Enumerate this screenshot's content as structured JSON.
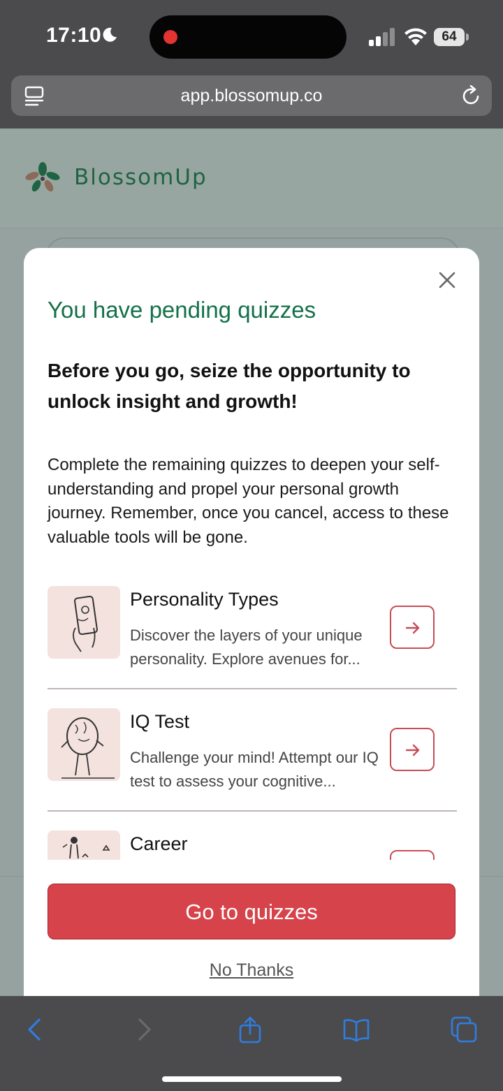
{
  "status_bar": {
    "time": "17:10",
    "battery": "64"
  },
  "browser": {
    "url": "app.blossomup.co"
  },
  "page": {
    "brand": "BlossomUp"
  },
  "modal": {
    "title": "You have pending quizzes",
    "subtitle": "Before you go, seize the opportunity to unlock insight and growth!",
    "body": "Complete the remaining quizzes to deepen your self-understanding and propel your personal growth journey. Remember, once you cancel, access to these valuable tools will be gone.",
    "quizzes": [
      {
        "name": "Personality Types",
        "description": "Discover the layers of your unique personality. Explore avenues for..."
      },
      {
        "name": "IQ Test",
        "description": "Challenge your mind! Attempt our IQ test to assess your cognitive..."
      },
      {
        "name": "Career",
        "description": ""
      }
    ],
    "cta_label": "Go to quizzes",
    "dismiss_label": "No Thanks"
  },
  "colors": {
    "accent_red": "#d6434a",
    "brand_green": "#137148",
    "thumb_bg": "#f3e2dd",
    "ios_blue": "#2f7de1"
  },
  "icons": [
    "moon-icon",
    "signal-icon",
    "wifi-icon",
    "battery-icon",
    "reader-icon",
    "reload-icon",
    "logo-flower-icon",
    "close-icon",
    "arrow-right-icon",
    "back-icon",
    "forward-icon",
    "share-icon",
    "bookmarks-icon",
    "tabs-icon"
  ]
}
